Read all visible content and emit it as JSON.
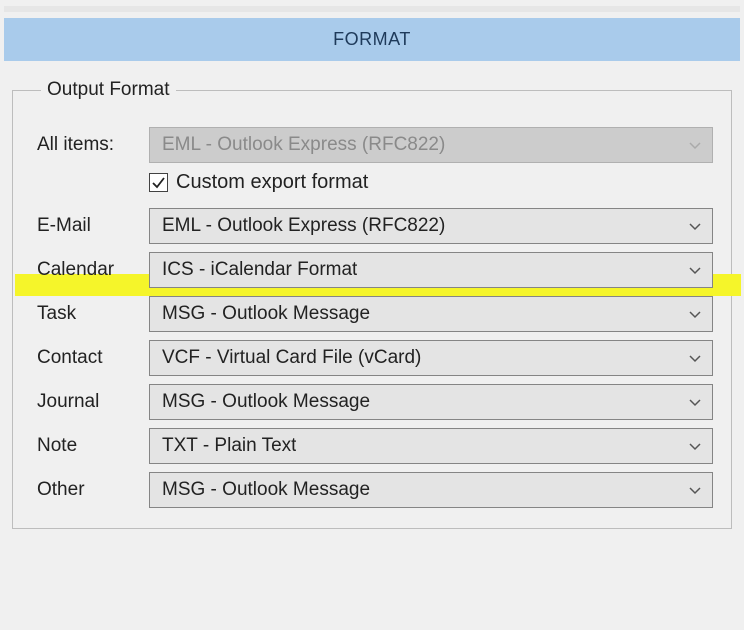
{
  "header": {
    "title": "FORMAT"
  },
  "fieldset": {
    "legend": "Output Format"
  },
  "all_items": {
    "label": "All items:",
    "value": "EML - Outlook Express (RFC822)"
  },
  "custom_export": {
    "label": "Custom export format",
    "checked": true
  },
  "rows": {
    "email": {
      "label": "E-Mail",
      "value": "EML - Outlook Express (RFC822)"
    },
    "calendar": {
      "label": "Calendar",
      "value": "ICS - iCalendar Format",
      "highlighted": true
    },
    "task": {
      "label": "Task",
      "value": "MSG - Outlook Message"
    },
    "contact": {
      "label": "Contact",
      "value": "VCF - Virtual Card File (vCard)"
    },
    "journal": {
      "label": "Journal",
      "value": "MSG - Outlook Message"
    },
    "note": {
      "label": "Note",
      "value": "TXT - Plain Text"
    },
    "other": {
      "label": "Other",
      "value": "MSG - Outlook Message"
    }
  }
}
